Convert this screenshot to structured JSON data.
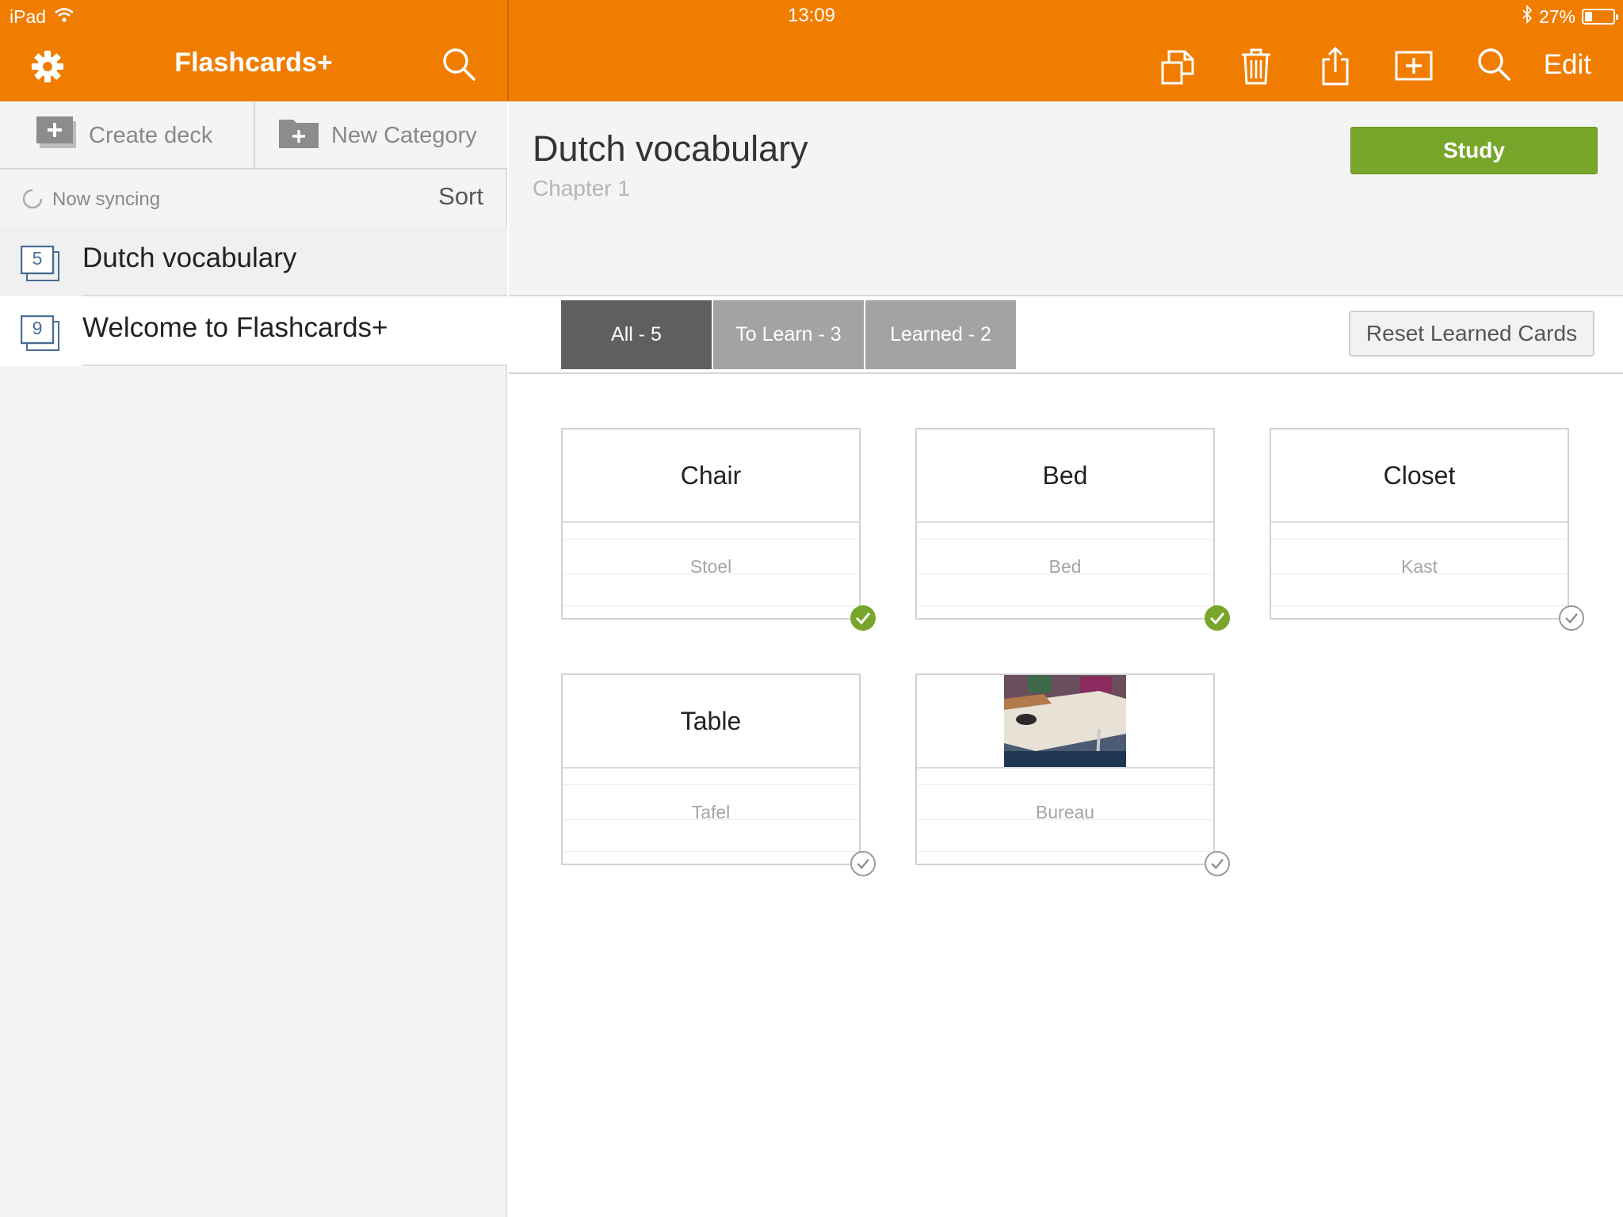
{
  "status_bar": {
    "device": "iPad",
    "time": "13:09",
    "battery": "27%",
    "battery_level": 0.27
  },
  "sidebar": {
    "title": "Flashcards+",
    "create_deck": "Create deck",
    "new_category": "New Category",
    "sync_status": "Now syncing",
    "sort": "Sort",
    "decks": [
      {
        "count": "5",
        "name": "Dutch vocabulary",
        "selected": true
      },
      {
        "count": "9",
        "name": "Welcome to Flashcards+",
        "selected": false
      }
    ]
  },
  "toolbar": {
    "icons": [
      "duplicate-icon",
      "trash-icon",
      "share-icon",
      "add-card-icon",
      "search-icon"
    ],
    "edit": "Edit"
  },
  "deck": {
    "title": "Dutch vocabulary",
    "subtitle": "Chapter 1",
    "study": "Study"
  },
  "filters": {
    "tabs": [
      {
        "label": "All - 5",
        "active": true
      },
      {
        "label": "To Learn - 3",
        "active": false
      },
      {
        "label": "Learned - 2",
        "active": false
      }
    ],
    "reset": "Reset Learned Cards"
  },
  "cards": [
    {
      "front": "Chair",
      "back": "Stoel",
      "learned": true
    },
    {
      "front": "Bed",
      "back": "Bed",
      "learned": true
    },
    {
      "front": "Closet",
      "back": "Kast",
      "learned": false
    },
    {
      "front": "Table",
      "back": "Tafel",
      "learned": false
    },
    {
      "front": "",
      "image": "desk-photo",
      "back": "Bureau",
      "learned": false
    }
  ],
  "colors": {
    "brand": "#f07d00",
    "study": "#78a62a",
    "tab_active": "#5f5f5f",
    "tab_inactive": "#a3a3a3"
  }
}
